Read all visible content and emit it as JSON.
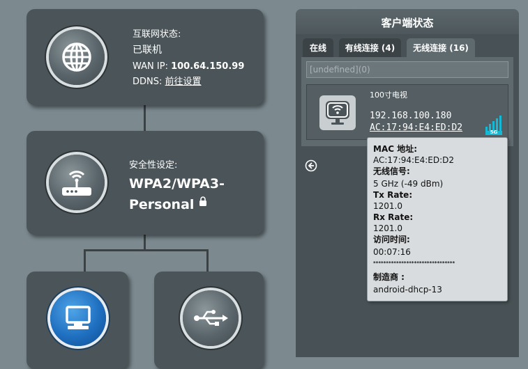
{
  "internet": {
    "status_label": "互联网状态:",
    "status_value": "已联机",
    "wan_label": "WAN IP:",
    "wan_ip": "100.64.150.99",
    "ddns_label": "DDNS:",
    "ddns_link": "前往设置"
  },
  "security": {
    "label": "安全性设定:",
    "value_line1": "WPA2/WPA3-",
    "value_line2": "Personal"
  },
  "panel": {
    "title": "客户端状态",
    "tabs": [
      {
        "label": "在线"
      },
      {
        "label": "有线连接 (4)"
      },
      {
        "label": "无线连接 (16)"
      }
    ],
    "search_placeholder": "[undefined](0)",
    "client": {
      "name": "100寸电视",
      "ip": "192.168.100.180",
      "mac": "AC:17:94:E4:ED:D2",
      "band_badge": "5G"
    }
  },
  "tooltip": {
    "mac_label": "MAC 地址:",
    "mac_value": "AC:17:94:E4:ED:D2",
    "signal_label": "无线信号:",
    "signal_value": "5 GHz (-49 dBm)",
    "tx_label": "Tx Rate:",
    "tx_value": "1201.0",
    "rx_label": "Rx Rate:",
    "rx_value": "1201.0",
    "access_label": "访问时间:",
    "access_value": "00:07:16",
    "separator": "********************************",
    "vendor_label": "制造商 :",
    "vendor_value": "android-dhcp-13"
  },
  "colors": {
    "background": "#7c8a90",
    "card": "#4b5559",
    "accent_blue": "#1f6fc0",
    "signal_teal": "#16b8d4"
  }
}
